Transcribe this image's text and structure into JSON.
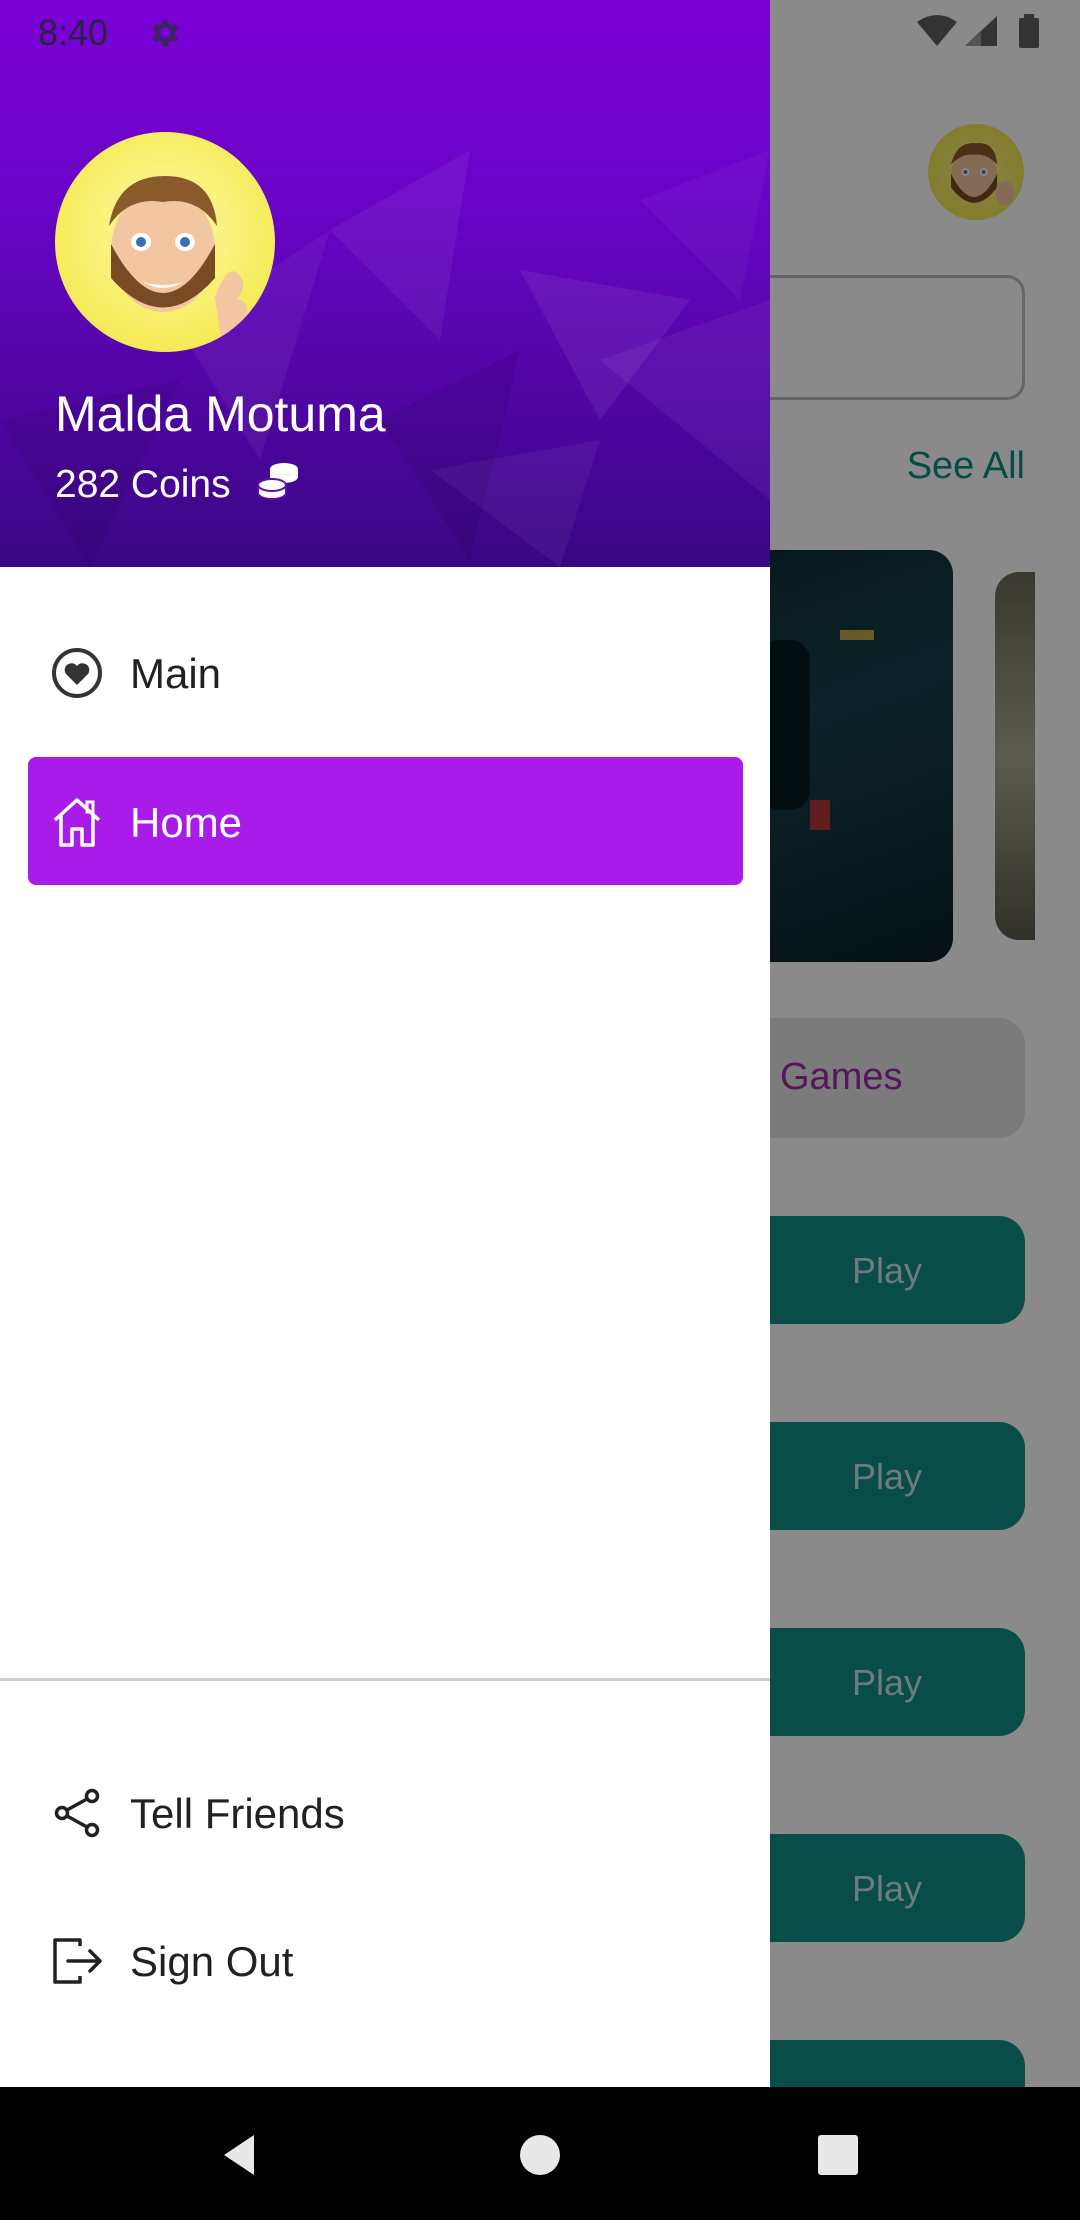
{
  "status_bar": {
    "time": "8:40"
  },
  "drawer": {
    "user": {
      "name": "Malda Motuma",
      "coins": "282 Coins"
    },
    "menu": [
      {
        "label": "Main",
        "icon": "heart-circle-icon",
        "active": false
      },
      {
        "label": "Home",
        "icon": "home-icon",
        "active": true
      }
    ],
    "footer_menu": [
      {
        "label": "Tell Friends",
        "icon": "share-icon"
      },
      {
        "label": "Sign Out",
        "icon": "sign-out-icon"
      }
    ]
  },
  "background_app": {
    "see_all": "See All",
    "category_chip": "Games",
    "play_buttons": [
      "Play",
      "Play",
      "Play",
      "Play"
    ]
  },
  "colors": {
    "header_purple": "#7b00d6",
    "active_item": "#a81be9",
    "teal": "#0f8f86"
  }
}
